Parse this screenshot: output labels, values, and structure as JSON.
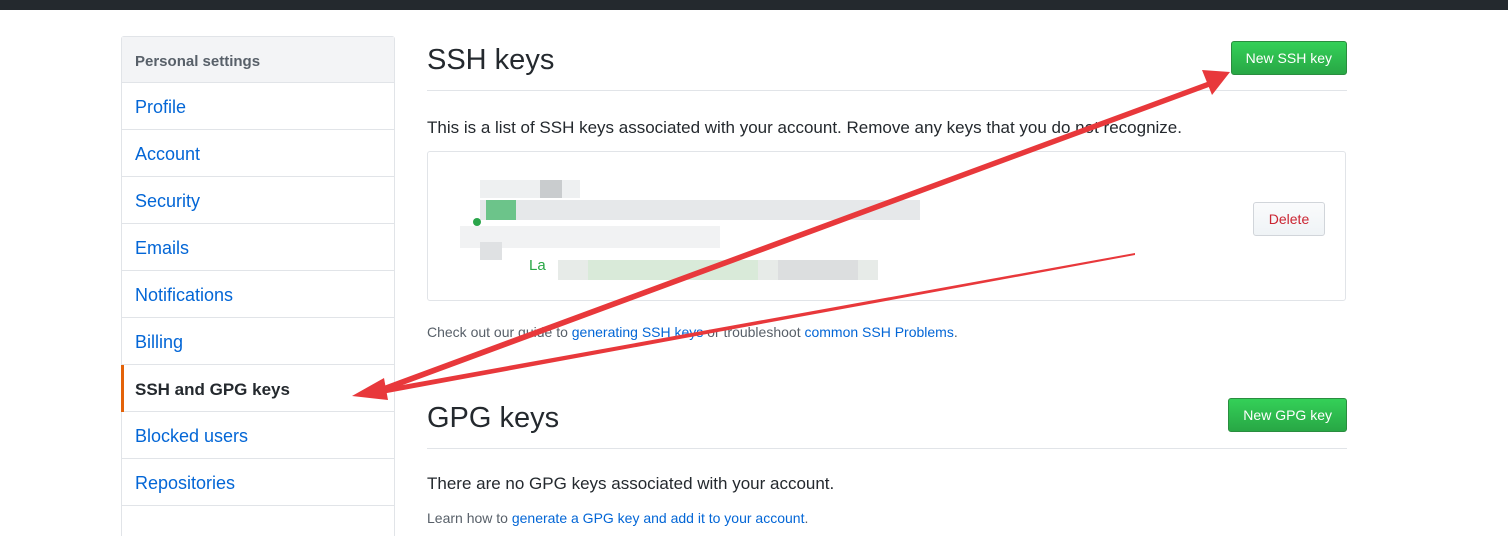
{
  "sidebar": {
    "header": "Personal settings",
    "items": [
      {
        "label": "Profile"
      },
      {
        "label": "Account"
      },
      {
        "label": "Security"
      },
      {
        "label": "Emails"
      },
      {
        "label": "Notifications"
      },
      {
        "label": "Billing"
      },
      {
        "label": "SSH and GPG keys",
        "active": true
      },
      {
        "label": "Blocked users"
      },
      {
        "label": "Repositories"
      }
    ]
  },
  "ssh": {
    "title": "SSH keys",
    "new_button": "New SSH key",
    "intro": "This is a list of SSH keys associated with your account. Remove any keys that you do not recognize.",
    "key_label": "La",
    "delete_button": "Delete",
    "guide_prefix": "Check out our guide to ",
    "guide_link1": "generating SSH keys",
    "guide_middle": " or troubleshoot ",
    "guide_link2": "common SSH Problems",
    "guide_suffix": "."
  },
  "gpg": {
    "title": "GPG keys",
    "new_button": "New GPG key",
    "empty_text": "There are no GPG keys associated with your account.",
    "learn_prefix": "Learn how to ",
    "learn_link": "generate a GPG key and add it to your account",
    "learn_suffix": "."
  },
  "colors": {
    "link": "#0366d6",
    "primary_button": "#28a745",
    "danger": "#cb2431",
    "active_indicator": "#e36209",
    "annotation_arrow": "#e8383b"
  }
}
